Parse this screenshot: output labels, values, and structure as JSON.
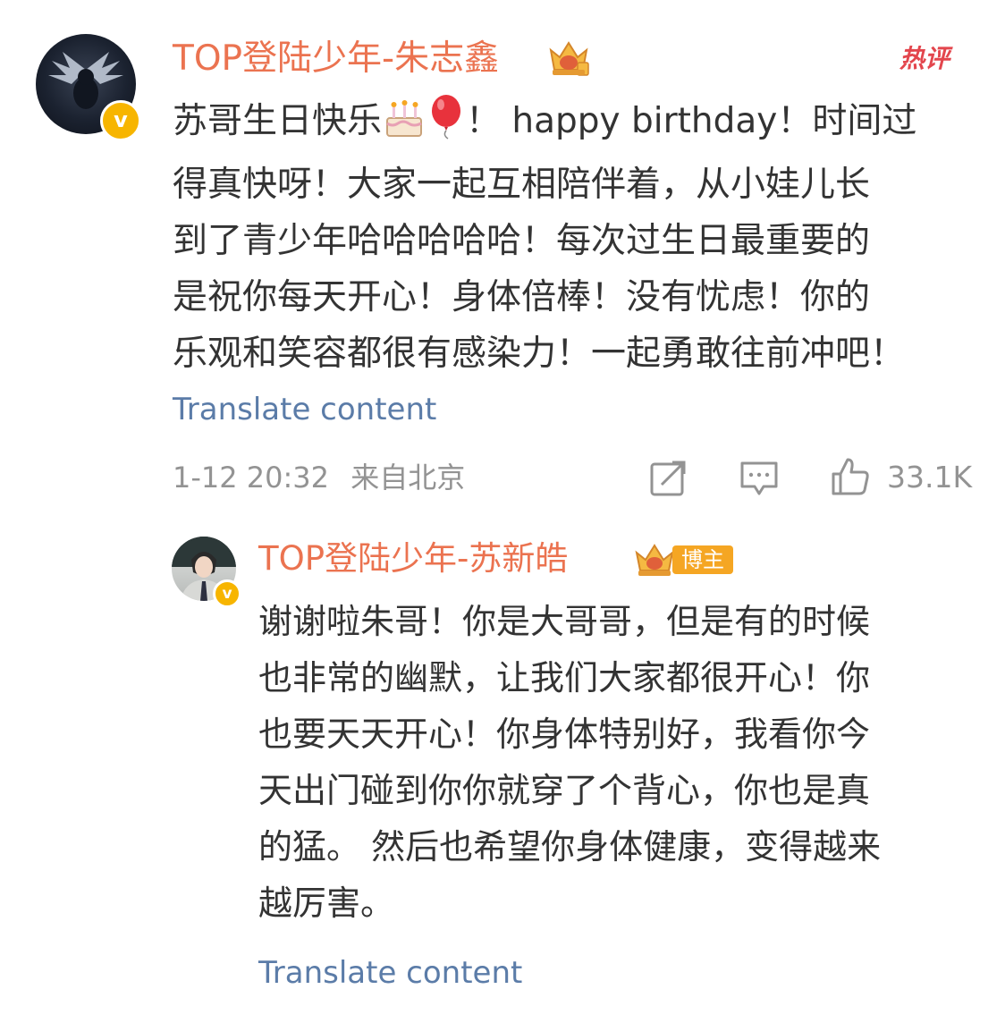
{
  "comment": {
    "username": "TOP登陆少年-朱志鑫",
    "badge_hot": "热评",
    "text_lines": [
      "苏哥生日快乐",
      "！ happy birthday！时间过",
      "得真快呀！大家一起互相陪伴着，从小娃儿长",
      "到了青少年哈哈哈哈哈！每次过生日最重要的",
      "是祝你每天开心！身体倍棒！没有忧虑！你的",
      "乐观和笑容都很有感染力！一起勇敢往前冲吧！"
    ],
    "translate_label": "Translate content",
    "timestamp": "1-12 20:32",
    "location": "来自北京",
    "like_count": "33.1K",
    "icons": [
      "verified-v-icon",
      "crown-badge-icon",
      "birthday-cake-emoji",
      "balloon-emoji",
      "repost-icon",
      "comment-icon",
      "like-icon"
    ],
    "verified_label": "v"
  },
  "reply": {
    "username": "TOP登陆少年-苏新皓",
    "blogger_tag": "博主",
    "verified_label": "v",
    "text_lines": [
      "谢谢啦朱哥！你是大哥哥，但是有的时候",
      "也非常的幽默，让我们大家都很开心！你",
      "也要天天开心！你身体特别好，我看你今",
      "天出门碰到你你就穿了个背心，你也是真",
      "的猛。 然后也希望你身体健康，变得越来",
      "越厉害。"
    ],
    "translate_label": "Translate content"
  },
  "colors": {
    "username": "#eb7350",
    "link": "#5b7ca8",
    "meta": "#939393",
    "verified": "#f7b500",
    "hot": "#e3464d"
  }
}
